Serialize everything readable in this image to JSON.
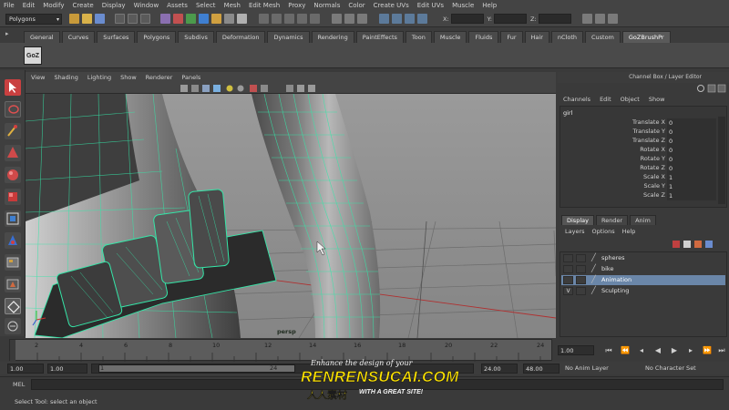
{
  "menubar": {
    "items": [
      "File",
      "Edit",
      "Modify",
      "Create",
      "Display",
      "Window",
      "Assets",
      "Select",
      "Mesh",
      "Edit Mesh",
      "Proxy",
      "Normals",
      "Color",
      "Create UVs",
      "Edit UVs",
      "Muscle",
      "Help"
    ]
  },
  "statusline": {
    "mode": "Polygons",
    "x_label": "X:",
    "y_label": "Y:",
    "z_label": "Z:"
  },
  "shelf": {
    "tabs": [
      "General",
      "Curves",
      "Surfaces",
      "Polygons",
      "Subdivs",
      "Deformation",
      "Dynamics",
      "Rendering",
      "PaintEffects",
      "Toon",
      "Muscle",
      "Fluids",
      "Fur",
      "Hair",
      "nCloth",
      "Custom",
      "GoZBrushPr"
    ],
    "active_tab": "GoZBrushPr",
    "goz_icon_label": "GoZ"
  },
  "viewport": {
    "menu": [
      "View",
      "Shading",
      "Lighting",
      "Show",
      "Renderer",
      "Panels"
    ],
    "camera_label": "persp"
  },
  "channel_box": {
    "title": "Channel Box / Layer Editor",
    "menu": [
      "Channels",
      "Edit",
      "Object",
      "Show"
    ],
    "object_name": "girl",
    "attributes": [
      {
        "name": "Translate X",
        "value": "0"
      },
      {
        "name": "Translate Y",
        "value": "0"
      },
      {
        "name": "Translate Z",
        "value": "0"
      },
      {
        "name": "Rotate X",
        "value": "0"
      },
      {
        "name": "Rotate Y",
        "value": "0"
      },
      {
        "name": "Rotate Z",
        "value": "0"
      },
      {
        "name": "Scale X",
        "value": "1"
      },
      {
        "name": "Scale Y",
        "value": "1"
      },
      {
        "name": "Scale Z",
        "value": "1"
      }
    ]
  },
  "layer_editor": {
    "tabs": [
      "Display",
      "Render",
      "Anim"
    ],
    "active_tab": "Display",
    "menu": [
      "Layers",
      "Options",
      "Help"
    ],
    "layers": [
      {
        "visible": "",
        "name": "spheres",
        "selected": false
      },
      {
        "visible": "",
        "name": "bike",
        "selected": false
      },
      {
        "visible": "",
        "name": "Animation",
        "selected": true
      },
      {
        "visible": "V",
        "name": "Sculpting",
        "selected": false
      }
    ]
  },
  "timeline": {
    "ticks": [
      "2",
      "4",
      "6",
      "8",
      "10",
      "12",
      "14",
      "16",
      "18",
      "20",
      "22",
      "24"
    ],
    "current_time": "1.00"
  },
  "range": {
    "start_time": "1.00",
    "playback_start": "1.00",
    "handle_start": "1",
    "handle_end": "24",
    "playback_end": "24.00",
    "end_time": "48.00",
    "anim_layer": "No Anim Layer",
    "character_set": "No Character Set"
  },
  "command_line": {
    "label": "MEL"
  },
  "help_line": {
    "text": "Select Tool: select an object"
  },
  "watermark": {
    "tagline": "Enhance the design of your",
    "brand": "RENRENSUCAI.COM",
    "chinese": "人人素材",
    "sub": "WITH A GREAT SITE!"
  },
  "colors": {
    "wireframe": "#35e6a8",
    "selection": "#6a86a8",
    "watermark_yellow": "#ffe400"
  }
}
